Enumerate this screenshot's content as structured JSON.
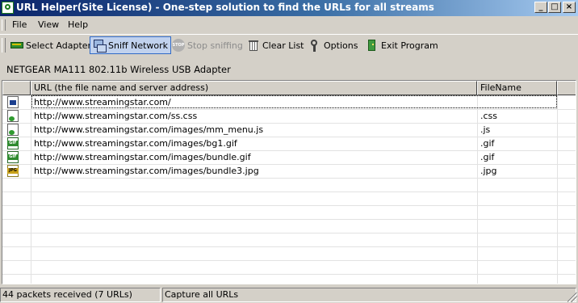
{
  "window": {
    "title": "URL Helper(Site License) - One-step solution to find the URLs for all streams",
    "minimize": "_",
    "maximize": "□",
    "close": "×"
  },
  "menu": [
    "File",
    "View",
    "Help"
  ],
  "toolbar": {
    "select_adapter": "Select Adapter",
    "sniff_network": "Sniff Network",
    "stop_sniffing": "Stop sniffing",
    "clear_list": "Clear List",
    "options": "Options",
    "exit_program": "Exit Program"
  },
  "adapter_name": "NETGEAR MA111 802.11b Wireless USB Adapter",
  "table": {
    "columns": [
      "URL (the file name and server address)",
      "FileName"
    ],
    "rows": [
      {
        "icon": "html-file-icon",
        "url": "http://www.streamingstar.com/",
        "filename": ""
      },
      {
        "icon": "css-file-icon",
        "url": "http://www.streamingstar.com/ss.css",
        "filename": ".css"
      },
      {
        "icon": "js-file-icon",
        "url": "http://www.streamingstar.com/images/mm_menu.js",
        "filename": ".js"
      },
      {
        "icon": "gif-file-icon",
        "url": "http://www.streamingstar.com/images/bg1.gif",
        "filename": ".gif"
      },
      {
        "icon": "gif-file-icon",
        "url": "http://www.streamingstar.com/images/bundle.gif",
        "filename": ".gif"
      },
      {
        "icon": "jpg-file-icon",
        "url": "http://www.streamingstar.com/images/bundle3.jpg",
        "filename": ".jpg"
      }
    ]
  },
  "status": {
    "packets": "44 packets received (7 URLs)",
    "mode": "Capture all URLs"
  },
  "colors": {
    "titlebar_start": "#0a246a",
    "titlebar_end": "#a6caf0",
    "chrome": "#d4d0c8",
    "active_button": "#c1d2ee"
  }
}
